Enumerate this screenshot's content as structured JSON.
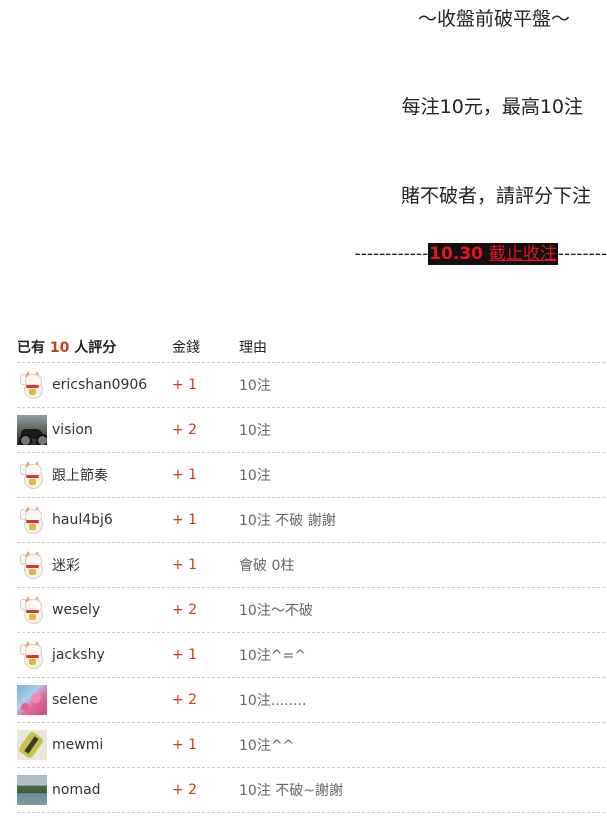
{
  "post": {
    "line1": "～收盤前破平盤～",
    "line2": "每注10元，最高10注",
    "line3": "賭不破者，請評分下注",
    "deadline_dashes_left": "------------",
    "deadline_bold": "10.30 ",
    "deadline_underlined": "截止收注",
    "deadline_dashes_right": "--------"
  },
  "ratings": {
    "header": {
      "prefix": "已有 ",
      "count": "10",
      "suffix": " 人評分",
      "score_label": "金錢",
      "reason_label": "理由"
    },
    "rows": [
      {
        "user": "ericshan0906",
        "avatar": "lucky-cat-icon",
        "score": "+ 1",
        "reason": "10注"
      },
      {
        "user": "vision",
        "avatar": "motorcycle-photo",
        "score": "+ 2",
        "reason": "10注"
      },
      {
        "user": "跟上節奏",
        "avatar": "lucky-cat-icon",
        "score": "+ 1",
        "reason": "10注"
      },
      {
        "user": "haul4bj6",
        "avatar": "lucky-cat-icon",
        "score": "+ 1",
        "reason": "10注 不破 謝謝"
      },
      {
        "user": "迷彩",
        "avatar": "lucky-cat-icon",
        "score": "+ 1",
        "reason": "會破 0柱"
      },
      {
        "user": "wesely",
        "avatar": "lucky-cat-icon",
        "score": "+ 2",
        "reason": "10注～不破"
      },
      {
        "user": "jackshy",
        "avatar": "lucky-cat-icon",
        "score": "+ 1",
        "reason": "10注^=^"
      },
      {
        "user": "selene",
        "avatar": "blossom-photo",
        "score": "+ 2",
        "reason": "10注........"
      },
      {
        "user": "mewmi",
        "avatar": "bird-photo",
        "score": "+ 1",
        "reason": "10注^^"
      },
      {
        "user": "nomad",
        "avatar": "landscape-photo",
        "score": "+ 2",
        "reason": "10注 不破~謝謝"
      }
    ]
  }
}
